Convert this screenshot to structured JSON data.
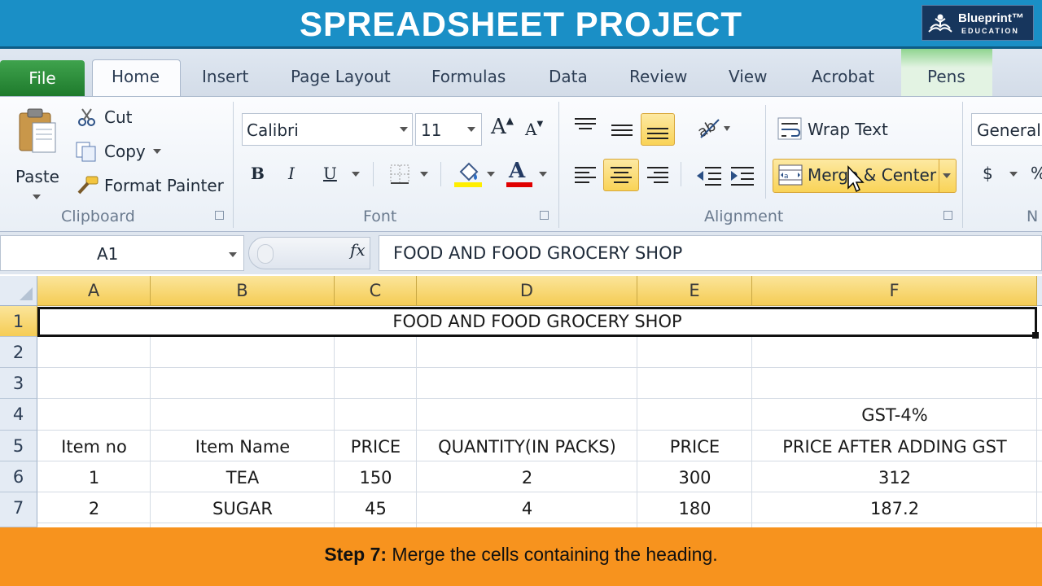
{
  "banner": {
    "title": "SPREADSHEET PROJECT",
    "logo_name": "Blueprint™",
    "logo_sub": "EDUCATION"
  },
  "tabs": [
    "File",
    "Home",
    "Insert",
    "Page Layout",
    "Formulas",
    "Data",
    "Review",
    "View",
    "Acrobat",
    "Pens"
  ],
  "ribbon": {
    "clipboard": {
      "paste": "Paste",
      "cut": "Cut",
      "copy": "Copy",
      "format_painter": "Format Painter",
      "label": "Clipboard"
    },
    "font": {
      "name": "Calibri",
      "size": "11",
      "bold": "B",
      "italic": "I",
      "underline": "U",
      "font_color_letter": "A",
      "label": "Font"
    },
    "alignment": {
      "wrap_text": "Wrap Text",
      "merge_center": "Merge & Center",
      "label": "Alignment"
    },
    "number": {
      "format": "General",
      "currency": "$",
      "percent": "%",
      "label_partial": "N"
    }
  },
  "formula_bar": {
    "name_box": "A1",
    "fx": "fx",
    "content": "FOOD AND FOOD GROCERY SHOP"
  },
  "sheet": {
    "columns": [
      "A",
      "B",
      "C",
      "D",
      "E",
      "F"
    ],
    "rows": [
      "1",
      "2",
      "3",
      "4",
      "5",
      "6",
      "7"
    ],
    "title": "FOOD AND FOOD GROCERY SHOP",
    "gst_label": "GST-4%",
    "headers": [
      "Item no",
      "Item Name",
      "PRICE",
      "QUANTITY(IN PACKS)",
      "PRICE",
      "PRICE AFTER ADDING GST"
    ],
    "data": [
      [
        "1",
        "TEA",
        "150",
        "2",
        "300",
        "312"
      ],
      [
        "2",
        "SUGAR",
        "45",
        "4",
        "180",
        "187.2"
      ]
    ]
  },
  "footer": {
    "step": "Step 7:",
    "text": " Merge the cells containing the heading."
  },
  "colors": {
    "banner": "#1a8fc6",
    "footer": "#f7931e",
    "selected_header": "#f5cc55",
    "file_tab": "#1e7a2c"
  }
}
